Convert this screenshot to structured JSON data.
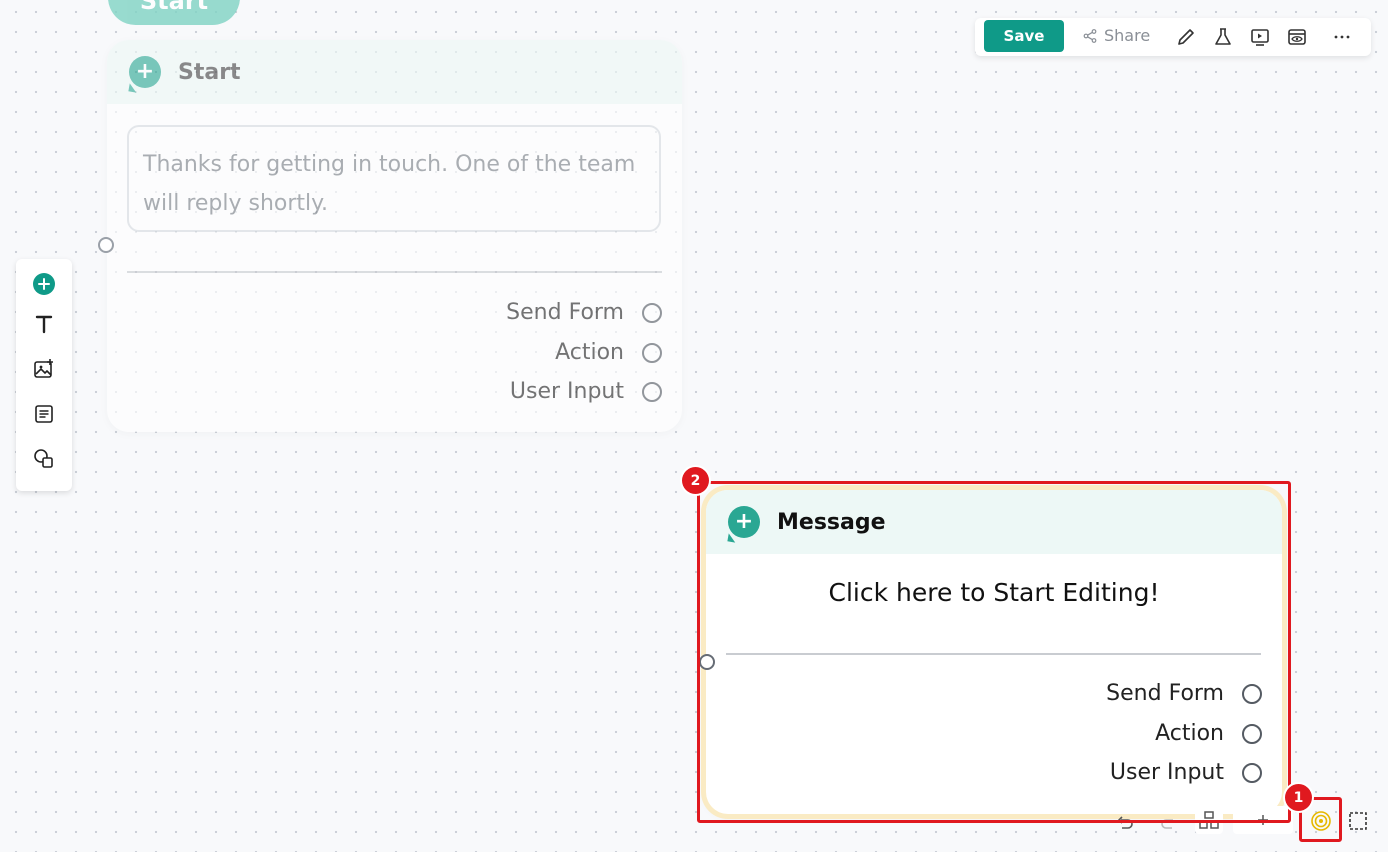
{
  "canvas": {
    "start_pill_label": "Start"
  },
  "start_node": {
    "title": "Start",
    "message": "Thanks for getting in touch. One of the team will reply shortly.",
    "options": [
      "Send Form",
      "Action",
      "User Input"
    ]
  },
  "message_node": {
    "title": "Message",
    "placeholder": "Click here to Start Editing!",
    "options": [
      "Send Form",
      "Action",
      "User Input"
    ]
  },
  "top_toolbar": {
    "save_label": "Save",
    "share_label": "Share",
    "icons": [
      "pencil-icon",
      "flask-icon",
      "play-screen-icon",
      "preview-eye-icon",
      "more-icon"
    ]
  },
  "left_toolbar": {
    "icons": [
      "add-node-icon",
      "text-icon",
      "image-add-icon",
      "document-icon",
      "shapes-icon"
    ]
  },
  "annotations": {
    "badge_1": "1",
    "badge_2": "2"
  },
  "colors": {
    "accent": "#0f9a88",
    "node_header_bg": "#edf8f6",
    "highlight_red": "#e0191f",
    "selected_glow": "#faebc4"
  }
}
